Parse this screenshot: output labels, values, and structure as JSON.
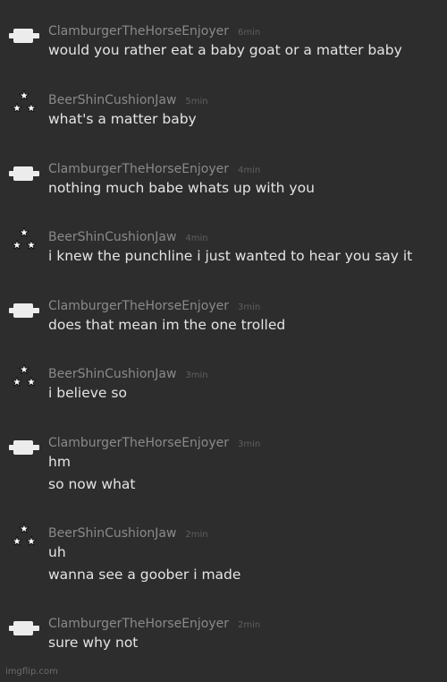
{
  "comments": [
    {
      "user": "ClamburgerTheHorseEnjoyer",
      "time": "6min",
      "avatar": "white-pill-icon",
      "lines": [
        "would you rather eat a baby goat or a matter baby"
      ]
    },
    {
      "user": "BeerShinCushionJaw",
      "time": "5min",
      "avatar": "three-stars-icon",
      "lines": [
        "what's a matter baby"
      ]
    },
    {
      "user": "ClamburgerTheHorseEnjoyer",
      "time": "4min",
      "avatar": "white-pill-icon",
      "lines": [
        "nothing much babe whats up with you"
      ]
    },
    {
      "user": "BeerShinCushionJaw",
      "time": "4min",
      "avatar": "three-stars-icon",
      "lines": [
        "i knew the punchline i just wanted to hear you say it"
      ]
    },
    {
      "user": "ClamburgerTheHorseEnjoyer",
      "time": "3min",
      "avatar": "white-pill-icon",
      "lines": [
        "does that mean im the one trolled"
      ]
    },
    {
      "user": "BeerShinCushionJaw",
      "time": "3min",
      "avatar": "three-stars-icon",
      "lines": [
        "i believe so"
      ]
    },
    {
      "user": "ClamburgerTheHorseEnjoyer",
      "time": "3min",
      "avatar": "white-pill-icon",
      "lines": [
        "hm",
        "so now what"
      ]
    },
    {
      "user": "BeerShinCushionJaw",
      "time": "2min",
      "avatar": "three-stars-icon",
      "lines": [
        "uh",
        "wanna see a goober i made"
      ]
    },
    {
      "user": "ClamburgerTheHorseEnjoyer",
      "time": "2min",
      "avatar": "white-pill-icon",
      "lines": [
        "sure why not"
      ]
    }
  ],
  "watermark": "imgflip.com"
}
